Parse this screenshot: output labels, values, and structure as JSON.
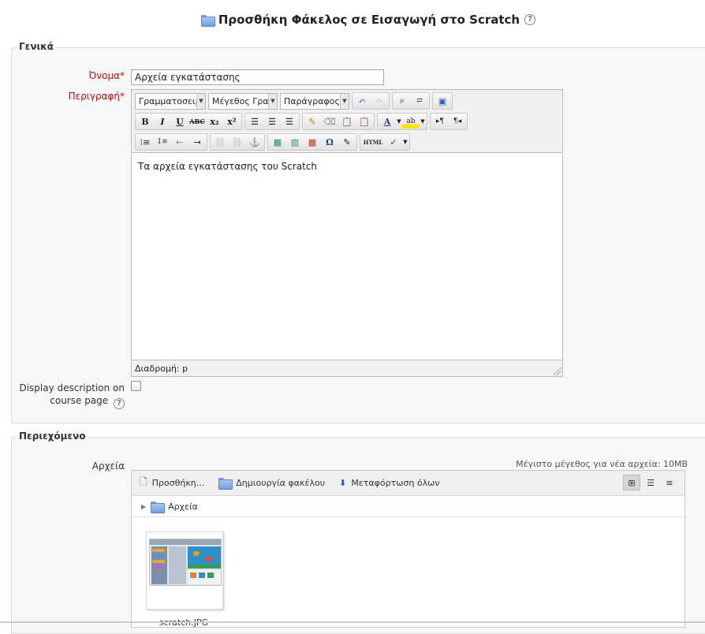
{
  "page": {
    "title": "Προσθήκη Φάκελος σε Εισαγωγή στο Scratch"
  },
  "general": {
    "legend": "Γενικά",
    "name_label": "Όνομα",
    "name_value": "Αρχεία εγκατάστασης",
    "description_label": "Περιγραφή",
    "required_star": "*",
    "editor": {
      "font_family": "Γραμματοσειρά",
      "font_size": "Μέγεθος Γραμμ",
      "paragraph": "Παράγραφος",
      "content": "Τα αρχεία εγκατάστασης του Scratch",
      "status_path": "Διαδρομή: p"
    },
    "display_description_label_line1": "Display description on",
    "display_description_label_line2": "course page",
    "display_description_checked": false
  },
  "content": {
    "legend": "Περιεχόμενο",
    "files_label": "Αρχεία",
    "max_size": "Μέγιστο μέγεθος για νέα αρχεία: 10MB",
    "actions": {
      "add": "Προσθήκη...",
      "create_folder": "Δημιουργία φακέλου",
      "download_all": "Μεταφόρτωση όλων"
    },
    "path_folder": "Αρχεία",
    "file": {
      "name": "scratch.JPG"
    }
  },
  "colors": {
    "required_label": "#aa1111",
    "folder_blue": "#6e9edb",
    "section_bg": "#f7f7f7"
  }
}
